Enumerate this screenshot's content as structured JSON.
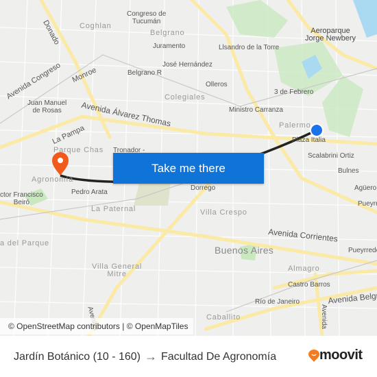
{
  "map": {
    "labels": {
      "coghlan": "Coghlan",
      "congreso": "Congreso de\nTucumán",
      "belgrano": "Belgrano",
      "juramento": "Juramento",
      "aeroparque": "Aeroparque\nJorge Newbery",
      "donado": "Donado",
      "congreso_av": "Avenida Congreso",
      "monroe": "Monroe",
      "lisandro": "Llsandro de la Torre",
      "jose": "José Hernández",
      "belgranoR": "Belgrano R",
      "olleros": "Olleros",
      "colegiales": "Colegiales",
      "tres_feb": "3 de Febrero",
      "juan_manuel": "Juan Manuel\nde Rosas",
      "alvarez": "Avenida Álvarez Thomas",
      "carranza": "Ministro Carranza",
      "palermo": "Palermo",
      "plaza_italia": "Plaza Italia",
      "la_pampa": "La Pampa",
      "parque_chas": "Parque Chas",
      "tronador": "Tronador -",
      "scalabrini": "Scalabrini Ortiz",
      "agronomia": "Agronomía",
      "bulnes": "Bulnes",
      "pedro_arata": "Pedro Arata",
      "dorrego": "Dorrego",
      "aguero": "Agüero",
      "beiro": "ctor Francisco\nBeiró",
      "paternal": "La Paternal",
      "pueyr": "Pueyrr",
      "villa_crespo": "Villa Crespo",
      "corrientes": "Avenida Corrientes",
      "del_parque": "a del Parque",
      "buenos_aires": "Buenos Aires",
      "pueyrredon": "Pueyrredó",
      "villa_general": "Villa General\nMitre",
      "almagro": "Almagro",
      "castro": "Castro Barros",
      "rio": "Río de Janeiro",
      "av_belgrano": "Avenida Belgr",
      "caballito": "Caballito",
      "avenida_v": "Avenida",
      "avenida_r": "Avenida"
    },
    "cta_label": "Take me there",
    "attribution": "© OpenStreetMap contributors | © OpenMapTiles",
    "colors": {
      "route": "#222222",
      "origin": "#1a73e8",
      "destination": "#f05a1a",
      "button": "#0f73d8",
      "road_major": "#fbe9a6",
      "park": "#c9e8c0",
      "water": "#aadaf2"
    }
  },
  "footer": {
    "origin": "Jardín Botánico (10 - 160)",
    "arrow": "→",
    "destination": "Facultad De Agronomía",
    "brand": "moovit"
  }
}
